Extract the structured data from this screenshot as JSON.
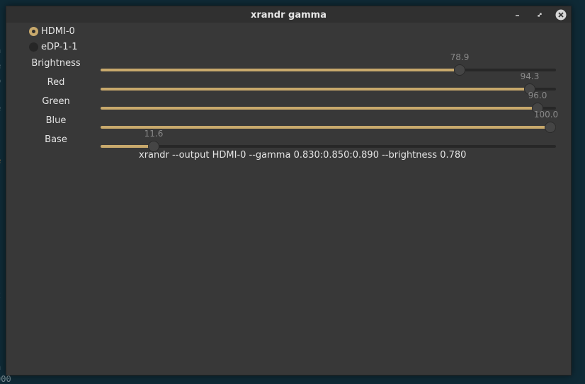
{
  "window": {
    "title": "xrandr gamma"
  },
  "titlebar_buttons": {
    "minimize_icon": "minimize-icon",
    "maximize_icon": "maximize-icon",
    "close_icon": "close-icon"
  },
  "outputs": [
    {
      "label": "HDMI-0",
      "selected": true
    },
    {
      "label": "eDP-1-1",
      "selected": false
    }
  ],
  "sliders": [
    {
      "label": "Brightness",
      "value": "78.9",
      "fraction": 0.789
    },
    {
      "label": "Red",
      "value": "94.3",
      "fraction": 0.943
    },
    {
      "label": "Green",
      "value": "96.0",
      "fraction": 0.96
    },
    {
      "label": "Blue",
      "value": "100.0",
      "fraction": 1.0
    },
    {
      "label": "Base",
      "value": "11.6",
      "fraction": 0.116
    }
  ],
  "command": "xrandr --output HDMI-0 --gamma 0.830:0.850:0.890 --brightness 0.780",
  "colors": {
    "accent": "#c8a96c",
    "window_bg": "#383838",
    "titlebar_bg": "#303030",
    "close_button": "#d6d6d6"
  }
}
